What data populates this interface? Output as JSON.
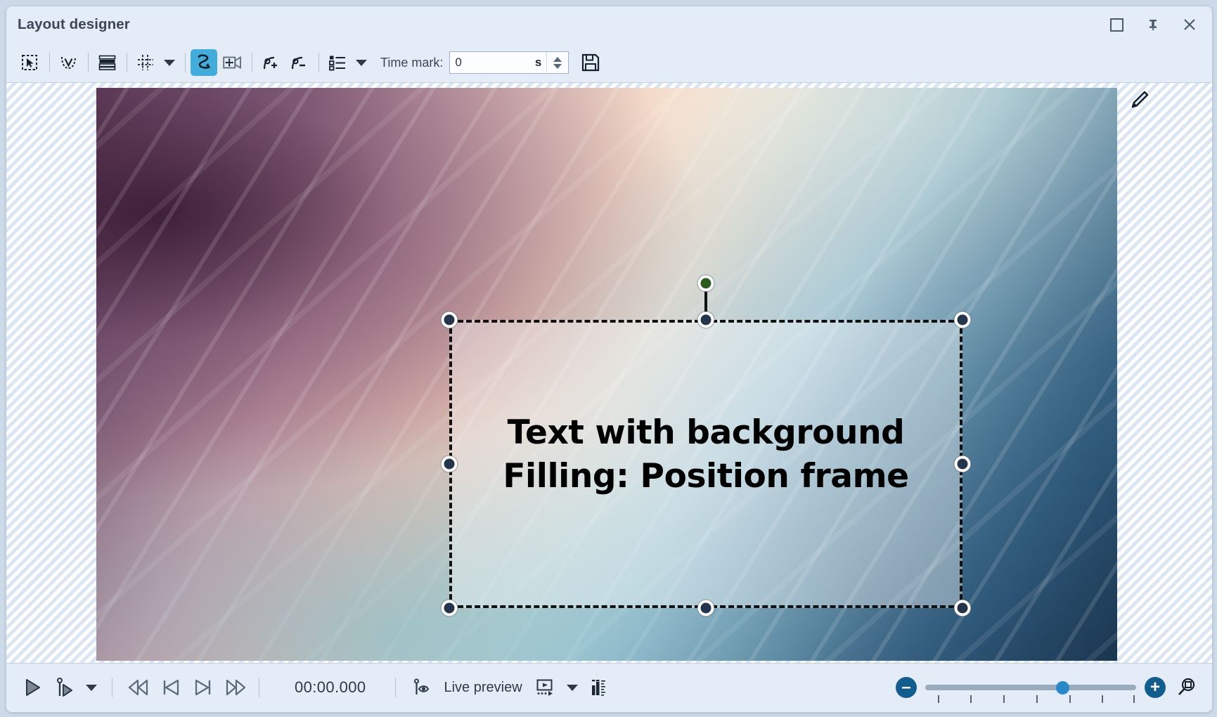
{
  "window": {
    "title": "Layout designer",
    "controls": [
      {
        "name": "maximize-button",
        "icon": "square-icon"
      },
      {
        "name": "pin-button",
        "icon": "pin-icon"
      },
      {
        "name": "close-button",
        "icon": "close-icon"
      }
    ]
  },
  "toolbar": {
    "tools": [
      {
        "name": "selection-tool-button",
        "icon": "selection-arrow-icon",
        "active": false
      },
      {
        "name": "snap-to-path-button",
        "icon": "dashed-check-icon",
        "active": false
      },
      {
        "name": "arrange-layers-button",
        "icon": "layers-stack-icon",
        "active": false
      },
      {
        "name": "grid-button",
        "icon": "grid-icon",
        "active": false
      },
      {
        "name": "grid-dropdown-button",
        "icon": "chevron-down-icon",
        "active": false
      },
      {
        "name": "motion-path-button",
        "icon": "motion-path-icon",
        "active": true
      },
      {
        "name": "camera-pan-button",
        "icon": "camera-move-icon",
        "active": false
      },
      {
        "name": "add-keyframe-button",
        "icon": "curve-plus-icon",
        "active": false
      },
      {
        "name": "remove-keyframe-button",
        "icon": "curve-minus-icon",
        "active": false
      },
      {
        "name": "properties-list-button",
        "icon": "list-properties-icon",
        "active": false
      },
      {
        "name": "properties-list-dropdown-button",
        "icon": "chevron-down-icon",
        "active": false
      }
    ],
    "time_mark_label": "Time mark:",
    "time_mark_value": "0",
    "time_mark_unit": "s",
    "save_button_icon": "floppy-save-icon",
    "accent_color": "#44acdb"
  },
  "canvas": {
    "brush_icon": "paint-brush-icon",
    "overlay_text_line1": "Text with background",
    "overlay_text_line2": "Filling: Position frame",
    "handles": [
      {
        "name": "rotation-handle",
        "position": "top-center-rotate",
        "color": "#2a5c20"
      },
      {
        "name": "resize-handle-top-left",
        "position": "top-left"
      },
      {
        "name": "resize-handle-top-center",
        "position": "top-center"
      },
      {
        "name": "resize-handle-top-right",
        "position": "top-right"
      },
      {
        "name": "resize-handle-middle-left",
        "position": "middle-left"
      },
      {
        "name": "resize-handle-middle-right",
        "position": "middle-right"
      },
      {
        "name": "resize-handle-bottom-left",
        "position": "bottom-left"
      },
      {
        "name": "resize-handle-bottom-center",
        "position": "bottom-center"
      },
      {
        "name": "resize-handle-bottom-right",
        "position": "bottom-right"
      }
    ]
  },
  "playback": {
    "buttons": [
      {
        "name": "play-button",
        "icon": "play-icon"
      },
      {
        "name": "play-from-cursor-button",
        "icon": "play-from-cursor-icon"
      },
      {
        "name": "play-options-dropdown",
        "icon": "chevron-down-icon"
      },
      {
        "name": "rewind-button",
        "icon": "rewind-icon"
      },
      {
        "name": "previous-frame-button",
        "icon": "skip-previous-icon"
      },
      {
        "name": "next-frame-button",
        "icon": "skip-next-icon"
      },
      {
        "name": "fast-forward-button",
        "icon": "fast-forward-icon"
      }
    ],
    "timecode": "00:00.000",
    "live_preview_label": "Live preview",
    "live_preview_icon": "eye-marker-icon",
    "render_preview_icon": "render-preview-icon",
    "render_preview_dropdown_icon": "chevron-down-icon",
    "audio_levels_icon": "audio-levels-icon"
  },
  "zoom": {
    "zoom_out_label": "–",
    "zoom_in_label": "+",
    "fit_icon": "fit-to-screen-icon",
    "slider_position_percent": 62
  }
}
